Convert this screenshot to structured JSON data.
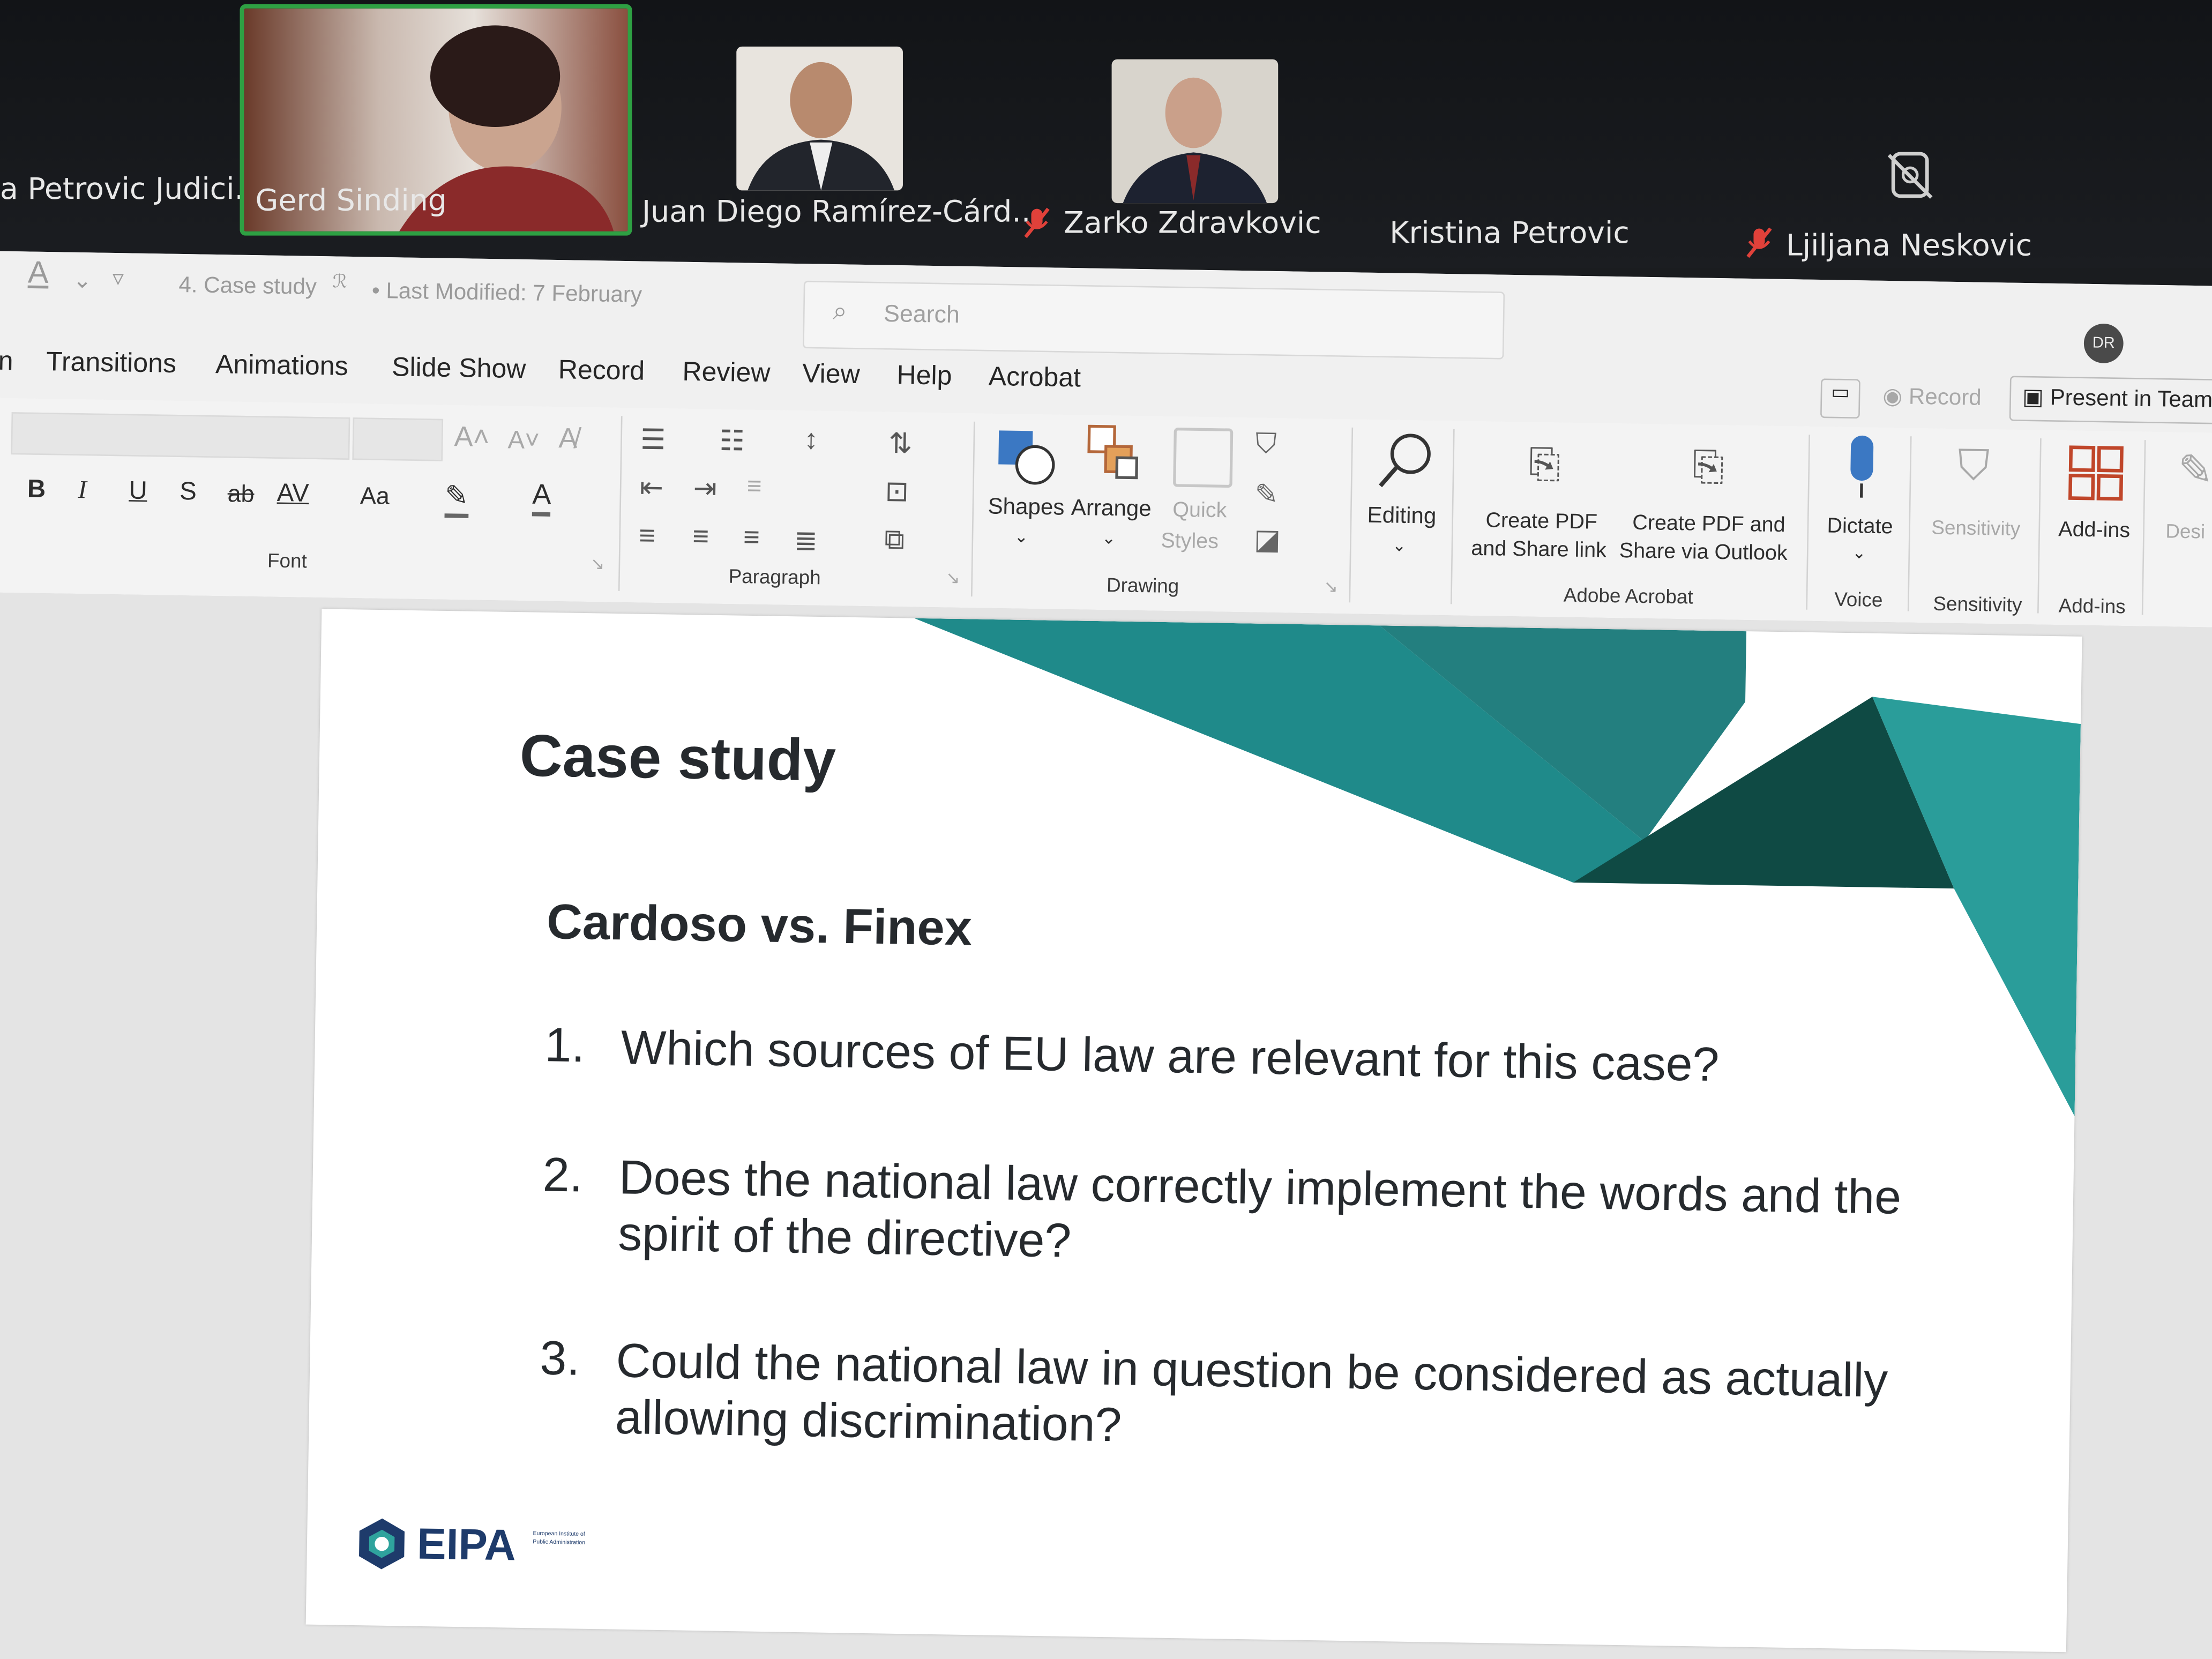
{
  "participants": [
    {
      "name": "a Petrovic Judici...",
      "muted": false,
      "video": false
    },
    {
      "name": "Gerd Sinding",
      "muted": false,
      "video": true,
      "active_speaker": true
    },
    {
      "name": "Juan Diego Ramírez-Cárd...",
      "muted": false,
      "video": true
    },
    {
      "name": "Zarko Zdravkovic",
      "muted": true,
      "video": true
    },
    {
      "name": "Kristina Petrovic",
      "muted": false,
      "video": false
    },
    {
      "name": "Ljiljana Neskovic",
      "muted": true,
      "video": false,
      "icon": "video-off-icon"
    }
  ],
  "titlebar": {
    "doc_title": "4. Case study",
    "last_modified": "• Last Modified: 7 February",
    "search_placeholder": "Search",
    "avatar_initials": "DR"
  },
  "menu": {
    "items": [
      "n",
      "Transitions",
      "Animations",
      "Slide Show",
      "Record",
      "Review",
      "View",
      "Help",
      "Acrobat"
    ]
  },
  "ribbon_right": {
    "record": "Record",
    "present": "Present in Team"
  },
  "ribbon": {
    "font": {
      "label": "Font",
      "buttons": [
        "B",
        "I",
        "U",
        "S",
        "ab",
        "AV",
        "Aa"
      ]
    },
    "paragraph": {
      "label": "Paragraph"
    },
    "drawing": {
      "label": "Drawing",
      "shapes": "Shapes",
      "arrange": "Arrange",
      "quick_styles_1": "Quick",
      "quick_styles_2": "Styles"
    },
    "editing": {
      "label": "Editing"
    },
    "acrobat": {
      "label": "Adobe Acrobat",
      "create_pdf_1": "Create PDF",
      "create_pdf_2": "and Share link",
      "create_pdf_outlook_1": "Create PDF and",
      "create_pdf_outlook_2": "Share via Outlook"
    },
    "voice": {
      "label": "Voice",
      "dictate": "Dictate"
    },
    "sensitivity": {
      "label": "Sensitivity",
      "button": "Sensitivity"
    },
    "addins": {
      "label": "Add-ins",
      "button": "Add-ins"
    },
    "design": {
      "button": "Desi"
    }
  },
  "slide": {
    "title": "Case study",
    "subtitle": "Cardoso vs. Finex",
    "questions": [
      {
        "num": "1.",
        "text": "Which sources of EU law are relevant for this case?"
      },
      {
        "num": "2.",
        "text": "Does the national law correctly implement the words and the spirit of the directive?"
      },
      {
        "num": "3.",
        "text": "Could the national law in question be considered as actually allowing discrimination?"
      }
    ],
    "logo_text": "EIPA",
    "logo_small": "European Institute of Public Administration",
    "accent_colors": [
      "#1f8a8a",
      "#0f4a44",
      "#2a9d9a"
    ]
  },
  "colors": {
    "zoom_bg": "#121417",
    "active_border": "#2ea043",
    "mute_red": "#e0413a",
    "slide_text": "#262a2e"
  }
}
